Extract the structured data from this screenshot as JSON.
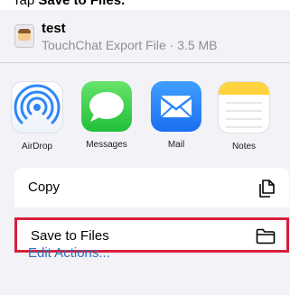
{
  "instruction": {
    "prefix": "Tap ",
    "bold": "Save to Files."
  },
  "file": {
    "title": "test",
    "subtitle": "TouchChat Export File · 3.5 MB",
    "icon": "file-thumbnail-icon"
  },
  "apps": [
    {
      "label": "AirDrop",
      "icon": "airdrop-icon"
    },
    {
      "label": "Messages",
      "icon": "messages-icon"
    },
    {
      "label": "Mail",
      "icon": "mail-icon"
    },
    {
      "label": "Notes",
      "icon": "notes-icon"
    }
  ],
  "actions": {
    "copy": {
      "label": "Copy",
      "icon": "copy-icon"
    },
    "save": {
      "label": "Save to Files",
      "icon": "folder-icon"
    },
    "edit": {
      "label": "Edit Actions..."
    }
  },
  "colors": {
    "highlight": "#d91e3b",
    "link": "#2f6fb8",
    "secondary_text": "#8e8e93"
  }
}
